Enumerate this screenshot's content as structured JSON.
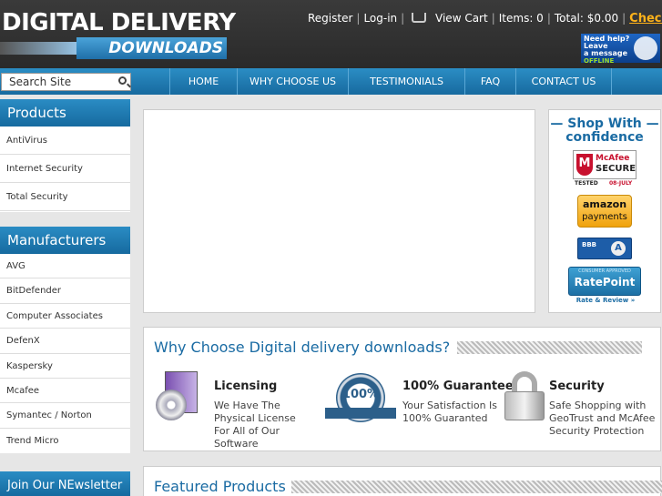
{
  "header": {
    "logo_top": "DIGITAL DELIVERY",
    "logo_bottom": "DOWNLOADS",
    "links": {
      "register": "Register",
      "login": "Log-in",
      "view_cart": "View Cart",
      "items": "Items: 0",
      "total": "Total: $0.00",
      "checkout": "Checkout"
    },
    "help": {
      "line1": "Need help?",
      "line2": "Leave",
      "line3": "a message",
      "line4": "OFFLINE"
    }
  },
  "nav": [
    "HOME",
    "WHY CHOOSE US",
    "TESTIMONIALS",
    "FAQ",
    "CONTACT US"
  ],
  "search": {
    "placeholder": "Search Site"
  },
  "sidebar": {
    "products_title": "Products",
    "products": [
      "AntiVirus",
      "Internet Security",
      "Total Security"
    ],
    "manufacturers_title": "Manufacturers",
    "manufacturers": [
      "AVG",
      "BitDefender",
      "Computer Associates",
      "DefenX",
      "Kaspersky",
      "Mcafee",
      "Symantec / Norton",
      "Trend Micro"
    ],
    "newsletter_title": "Join Our NEwsletter"
  },
  "shop": {
    "title_line1": "Shop With",
    "title_line2": "confidence",
    "mcafee": {
      "brand": "McAfee",
      "secure": "SECURE",
      "tested": "TESTED",
      "date": "08-JULY"
    },
    "amazon": {
      "line1": "amazon",
      "line2": "payments"
    },
    "bbb": {
      "label": "BBB",
      "grade": "A"
    },
    "ratepoint": {
      "top": "CONSUMER APPROVED",
      "name": "RatePoint",
      "sub": "Rate & Review »"
    }
  },
  "why": {
    "title": "Why Choose Digital delivery downloads?",
    "features": [
      {
        "title": "Licensing",
        "text": "We Have The Physical License For All of Our Software"
      },
      {
        "title": "100% Guarantee",
        "text": "Your Satisfaction Is 100% Guaranted"
      },
      {
        "title": "Security",
        "text": "Safe Shopping with GeoTrust and McAfee Security Protection"
      }
    ],
    "seal_text": "100%"
  },
  "featured": {
    "title": "Featured Products"
  },
  "colors": {
    "accent": "#1a6ba3",
    "nav": "#2189c1",
    "checkout": "#ffb31a"
  }
}
